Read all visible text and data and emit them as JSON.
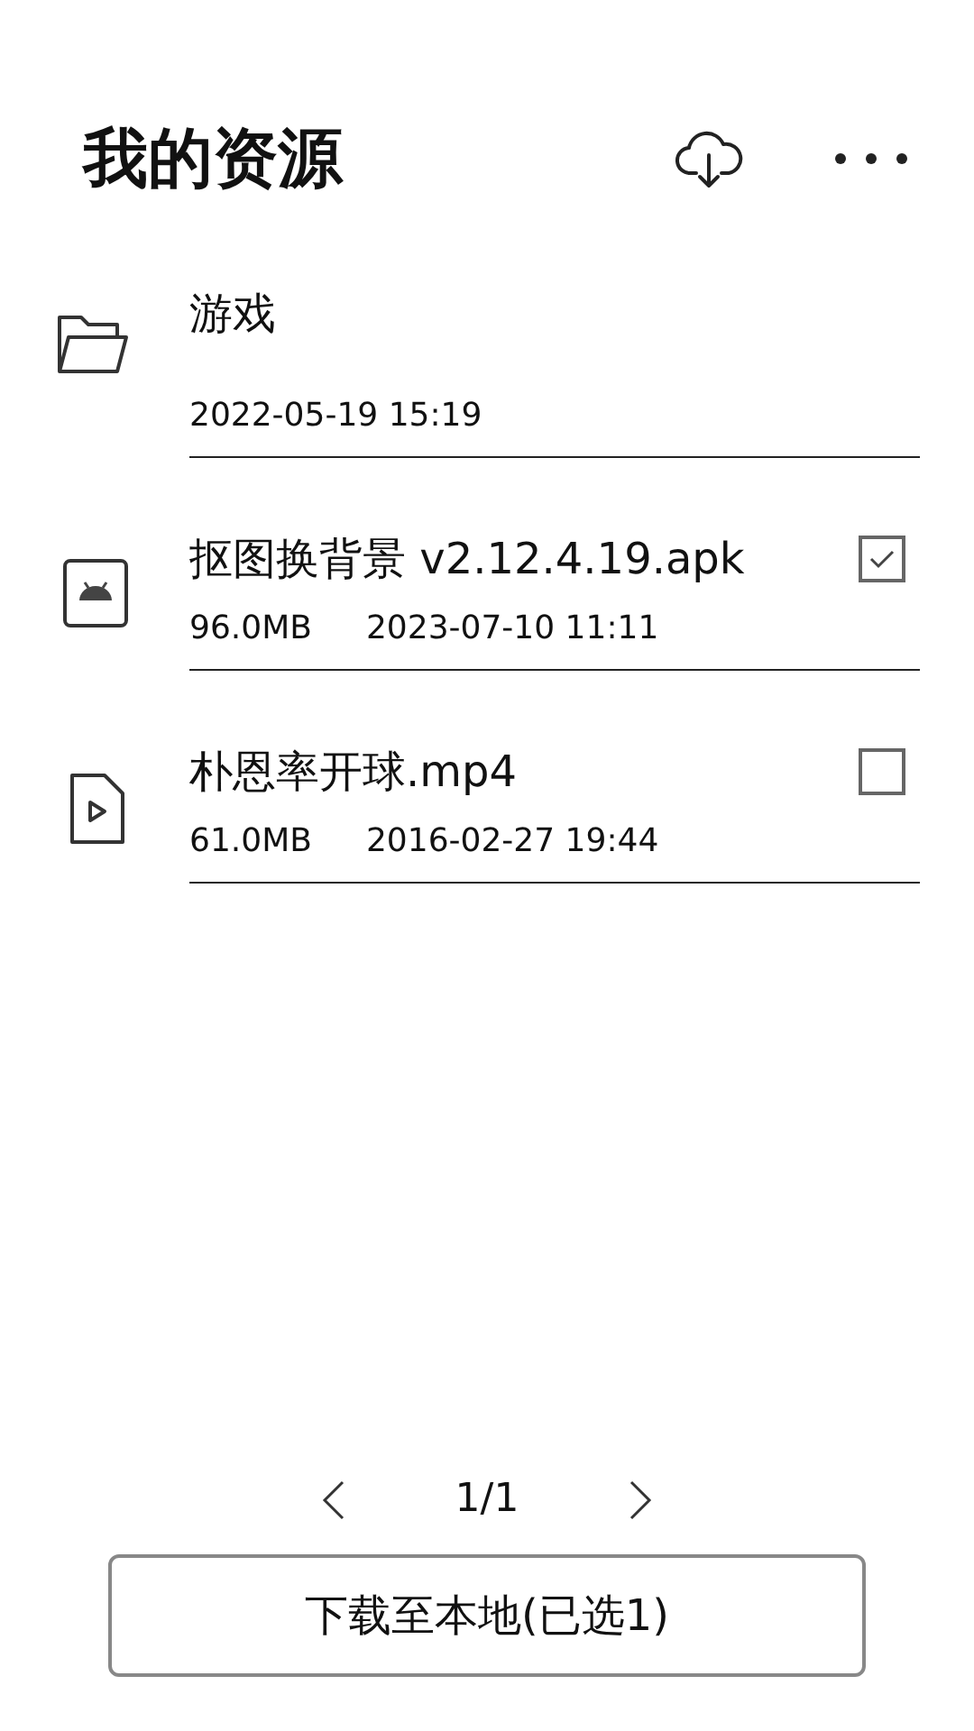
{
  "header": {
    "title": "我的资源"
  },
  "items": [
    {
      "kind": "folder",
      "name": "游戏",
      "date": "2022-05-19 15:19"
    },
    {
      "kind": "apk",
      "name": "抠图换背景 v2.12.4.19.apk",
      "size": "96.0MB",
      "date": "2023-07-10 11:11",
      "checked": true
    },
    {
      "kind": "video",
      "name": "朴恩率开球.mp4",
      "size": "61.0MB",
      "date": "2016-02-27 19:44",
      "checked": false
    }
  ],
  "pager": {
    "page": "1/1"
  },
  "download_button": {
    "label": "下载至本地(已选1)"
  }
}
